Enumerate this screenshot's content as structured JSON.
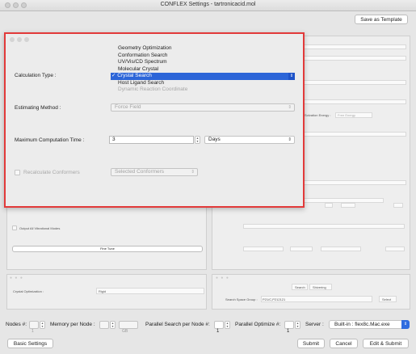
{
  "window": {
    "title": "CONFLEX Settings - tartronicacid.mol"
  },
  "header": {
    "save_template": "Save as Template"
  },
  "dialog": {
    "calc_type_label": "Calculation Type :",
    "calc_options": [
      {
        "label": "Geometry Optimization",
        "enabled": true,
        "selected": false
      },
      {
        "label": "Conformation Search",
        "enabled": true,
        "selected": false
      },
      {
        "label": "UV/Vis/CD Spectrum",
        "enabled": true,
        "selected": false
      },
      {
        "label": "Molecular Crystal",
        "enabled": true,
        "selected": false
      },
      {
        "label": "✓ Crystal Search",
        "enabled": true,
        "selected": true
      },
      {
        "label": "Host Ligand Search",
        "enabled": true,
        "selected": false
      },
      {
        "label": "Dynamic Reaction Coordinate",
        "enabled": false,
        "selected": false
      }
    ],
    "estimating_label": "Estimating Method :",
    "estimating_value": "Force Field",
    "max_time_label": "Maximum Computation Time :",
    "max_time_value": "3",
    "max_time_unit": "Days",
    "recalc_label": "Recalculate Conformers",
    "recalc_value": "Selected Conformers"
  },
  "background": {
    "solvation_label": "Solvation Energy :",
    "solvation_value": "Free Energy",
    "output_vib_label": "Output All Vibrational Modes",
    "fine_tune": "Fine Tune",
    "crystal_opt_label": "Crystal Optimization :",
    "crystal_opt_value": "Rigid",
    "tabs": [
      "Search",
      "Shivering"
    ],
    "space_group_label": "Search Space Group :",
    "space_group_value": "P21/C,P212121",
    "select": "Select"
  },
  "bottom": {
    "nodes_label": "Nodes #:",
    "nodes_value": "1",
    "memory_label": "Memory per Node :",
    "memory_unit": "GB",
    "parallel_search_label": "Parallel Search per Node #:",
    "parallel_search_value": "1",
    "parallel_opt_label": "Parallel Optimize #:",
    "parallel_opt_value": "1",
    "server_label": "Server :",
    "server_value": "Built-in : flex8c.Mac.exe"
  },
  "footer": {
    "basic_settings": "Basic Settings",
    "submit": "Submit",
    "cancel": "Cancel",
    "edit_submit": "Edit & Submit"
  },
  "colors": {
    "accent": "#2c65d8",
    "highlight_border": "#e23a3a"
  }
}
